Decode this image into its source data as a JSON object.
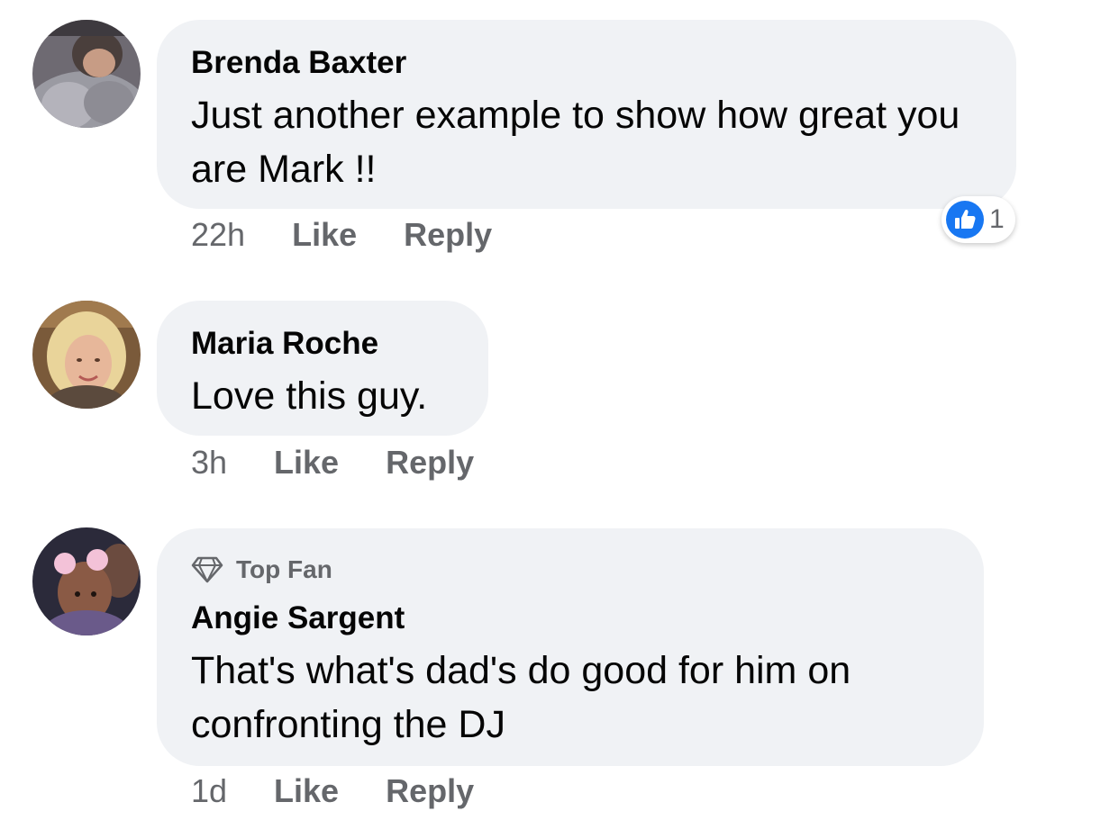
{
  "colors": {
    "bubble_bg": "#f0f2f5",
    "secondary_text": "#65676b",
    "like_blue": "#1877f2"
  },
  "comments": [
    {
      "author": "Brenda Baxter",
      "badge": "",
      "text": "Just another example to show how great you are Mark !!",
      "time": "22h",
      "like_label": "Like",
      "reply_label": "Reply",
      "reaction_icon": "like-thumbs-up-icon",
      "reaction_count": "1"
    },
    {
      "author": "Maria Roche",
      "badge": "",
      "text": "Love this guy.",
      "time": "3h",
      "like_label": "Like",
      "reply_label": "Reply"
    },
    {
      "author": "Angie Sargent",
      "badge": "Top Fan",
      "badge_icon": "diamond-icon",
      "text": "That's what's dad's do good for him on confronting the DJ",
      "time": "1d",
      "like_label": "Like",
      "reply_label": "Reply"
    }
  ]
}
